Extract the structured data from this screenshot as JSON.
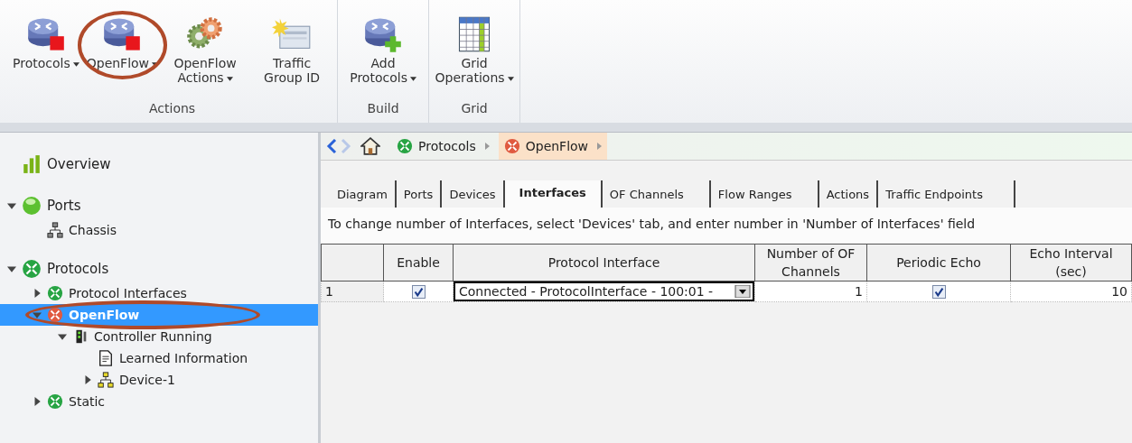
{
  "ribbon": {
    "groups": [
      {
        "label": "Actions",
        "buttons": [
          {
            "label": "Protocols",
            "kind": "router",
            "dropdown": true,
            "circled": false
          },
          {
            "label": "OpenFlow",
            "kind": "router",
            "dropdown": true,
            "circled": true
          },
          {
            "label": "OpenFlow Actions",
            "kind": "gears",
            "dropdown": true,
            "circled": false
          },
          {
            "label": "Traffic Group ID",
            "kind": "window",
            "dropdown": false,
            "circled": false
          }
        ]
      },
      {
        "label": "Build",
        "buttons": [
          {
            "label": "Add Protocols",
            "kind": "router-add",
            "dropdown": true,
            "circled": false
          }
        ]
      },
      {
        "label": "Grid",
        "buttons": [
          {
            "label": "Grid Operations",
            "kind": "grid",
            "dropdown": true,
            "circled": false
          }
        ]
      }
    ]
  },
  "tree": [
    {
      "label": "Overview",
      "kind": "chart",
      "selected": false,
      "circled": false
    },
    {
      "label": "Ports",
      "kind": "ports",
      "expanded": true,
      "selected": false,
      "circled": false,
      "children": [
        {
          "label": "Chassis",
          "kind": "topology",
          "selected": false,
          "circled": false
        }
      ]
    },
    {
      "label": "Protocols",
      "kind": "protocol",
      "expanded": true,
      "selected": false,
      "circled": false,
      "children": [
        {
          "label": "Protocol Interfaces",
          "kind": "protocol",
          "expanded": false,
          "selected": false,
          "circled": false
        },
        {
          "label": "OpenFlow",
          "kind": "openflow",
          "expanded": true,
          "selected": true,
          "circled": true,
          "children": [
            {
              "label": "Controller Running",
              "kind": "controller",
              "expanded": true,
              "selected": false,
              "circled": false,
              "children": [
                {
                  "label": "Learned Information",
                  "kind": "document",
                  "selected": false,
                  "circled": false
                },
                {
                  "label": "Device-1",
                  "kind": "device",
                  "expanded": false,
                  "selected": false,
                  "circled": false
                }
              ]
            }
          ]
        },
        {
          "label": "Static",
          "kind": "protocol",
          "expanded": false,
          "selected": false,
          "circled": false
        }
      ]
    }
  ],
  "breadcrumb": [
    {
      "label": "Protocols",
      "kind": "protocol",
      "selected": false
    },
    {
      "label": "OpenFlow",
      "kind": "openflow",
      "selected": true
    }
  ],
  "tabs": [
    {
      "label": "Diagram",
      "selected": false
    },
    {
      "label": "Ports",
      "selected": false
    },
    {
      "label": "Devices",
      "selected": false
    },
    {
      "label": "Interfaces",
      "selected": true
    },
    {
      "label": "OF Channels",
      "selected": false
    },
    {
      "label": "Flow Ranges",
      "selected": false
    },
    {
      "label": "Actions",
      "selected": false
    },
    {
      "label": "Traffic Endpoints",
      "selected": false
    }
  ],
  "hint": "To change number of Interfaces, select 'Devices' tab, and enter number in 'Number of Interfaces' field",
  "table": {
    "columns": [
      "Enable",
      "Protocol Interface",
      "Number of OF Channels",
      "Periodic Echo",
      "Echo Interval (sec)"
    ],
    "rows": [
      {
        "index": "1",
        "enable": true,
        "interface": "Connected - ProtocolInterface - 100:01 -",
        "channels": "1",
        "periodic_echo": true,
        "interval": "10"
      }
    ]
  }
}
